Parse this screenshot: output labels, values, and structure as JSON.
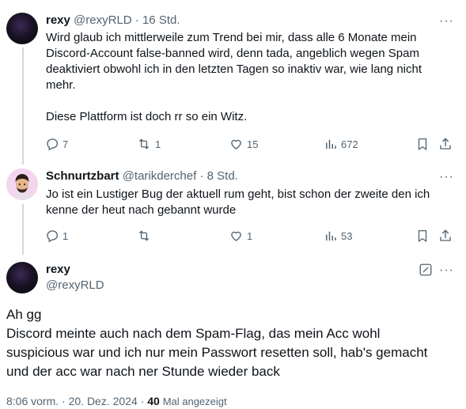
{
  "tweet1": {
    "name": "rexy",
    "handle": "@rexyRLD",
    "sep": "·",
    "time": "16 Std.",
    "lines": [
      "Wird glaub ich mittlerweile zum Trend bei mir, dass alle 6 Monate mein",
      "Discord-Account false-banned wird, denn tada, angeblich wegen Spam",
      "deaktiviert obwohl ich in den letzten Tagen so inaktiv war, wie lang nicht",
      "mehr.",
      "Diese Plattform ist doch rr so ein Witz."
    ],
    "replies": "7",
    "reposts": "1",
    "likes": "15",
    "views": "672"
  },
  "tweet2": {
    "name": "Schnurtzbart",
    "handle": "@tarikderchef",
    "sep": "·",
    "time": "8 Std.",
    "lines": [
      "Jo ist ein Lustiger Bug der aktuell rum geht, bist schon der zweite den ich",
      "kenne der heut nach gebannt wurde"
    ],
    "replies": "1",
    "reposts": "",
    "likes": "1",
    "views": "53"
  },
  "main": {
    "name": "rexy",
    "handle": "@rexyRLD",
    "lines": [
      "Ah gg",
      "Discord meinte auch nach dem Spam-Flag, das mein Acc wohl",
      "suspicious war und ich nur mein Passwort resetten soll, hab's gemacht",
      "und der acc war nach ner Stunde wieder back"
    ],
    "timestamp": "8:06 vorm.",
    "sep": "·",
    "date": "20. Dez. 2024",
    "views_count": "40",
    "views_label": "Mal angezeigt"
  },
  "icons": {
    "more": "more-dots-icon",
    "reply": "reply-icon",
    "repost": "repost-icon",
    "like": "heart-icon",
    "views": "views-chart-icon",
    "bookmark": "bookmark-icon",
    "share": "share-icon",
    "edit": "edit-icon"
  }
}
